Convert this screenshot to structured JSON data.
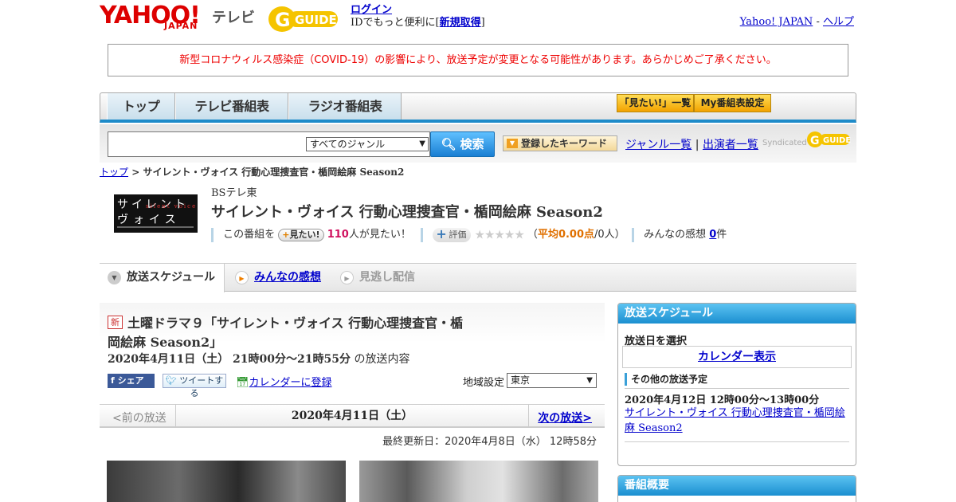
{
  "header": {
    "yahoo_logo": "YAHOO!",
    "japan_logo": "JAPAN",
    "tv_label": "テレビ",
    "gguide_logo": "G GUIDE",
    "login_link": "ログイン",
    "login_prefix": "IDでもっと便利に[",
    "signup_link": "新規取得",
    "login_suffix": "]",
    "yahoo_japan_link": "Yahoo! JAPAN",
    "separator": "-",
    "help_link": "ヘルプ"
  },
  "notice": "新型コロナウィルス感染症（COVID-19）の影響により、放送予定が変更となる可能性があります。あらかじめご了承ください。",
  "nav": {
    "tabs": [
      "トップ",
      "テレビ番組表",
      "ラジオ番組表"
    ],
    "mitai_list": "「見たい!」一覧",
    "my_schedule": "My番組表設定"
  },
  "search": {
    "genre_selected": "すべてのジャンル",
    "button": "検索",
    "keyword_button": "登録したキーワード",
    "genre_list": "ジャンル一覧",
    "link_sep": "|",
    "performer_list": "出演者一覧",
    "syndicated": "Syndicated"
  },
  "breadcrumb": {
    "top": "トップ",
    "sep": ">",
    "current": "サイレント・ヴォイス 行動心理捜査官・楯岡絵麻 Season2"
  },
  "program": {
    "thumb_line1": "サイレント",
    "thumb_line2": "ヴォイス",
    "thumb_sub": "silent voice",
    "channel": "BSテレ東",
    "title": "サイレント・ヴォイス 行動心理捜査官・楯岡絵麻 Season2",
    "want_prefix": "この番組を",
    "want_button": "見たい!",
    "want_count": "110",
    "want_suffix": "人が見たい！",
    "rating_label": "評価",
    "stars": "★★★★★",
    "avg_open": "（",
    "avg_label": "平均0.00点",
    "avg_rest": "/0人）",
    "impressions_label": "みんなの感想",
    "impressions_count": "0",
    "impressions_suffix": "件"
  },
  "tabs": {
    "schedule": "放送スケジュール",
    "impressions": "みんなの感想",
    "missed": "見逃し配信"
  },
  "episode": {
    "new_badge": "新",
    "title_line1": "土曜ドラマ９「サイレント・ヴォイス 行動心理捜査官・楯",
    "title_line2": "岡絵麻 Season2」",
    "date": "2020年4月11日（土）  21時00分～21時55分",
    "date_suffix": "の放送内容",
    "fb_share": "シェア",
    "tweet": "ツイートする",
    "calendar_link": "カレンダーに登録",
    "region_label": "地域設定",
    "region_value": "東京",
    "prev": "<前の放送",
    "current_date": "2020年4月11日（土）",
    "next": "次の放送>",
    "updated": "最終更新日：2020年4月8日（水） 12時58分"
  },
  "sidebar": {
    "schedule_head": "放送スケジュール",
    "select_date": "放送日を選択",
    "calendar_view": "カレンダー表示",
    "other_head": "その他の放送予定",
    "other_date": "2020年4月12日  12時00分～13時00分",
    "other_title": "サイレント・ヴォイス 行動心理捜査官・楯岡絵麻 Season2",
    "overview_head": "番組概要"
  }
}
